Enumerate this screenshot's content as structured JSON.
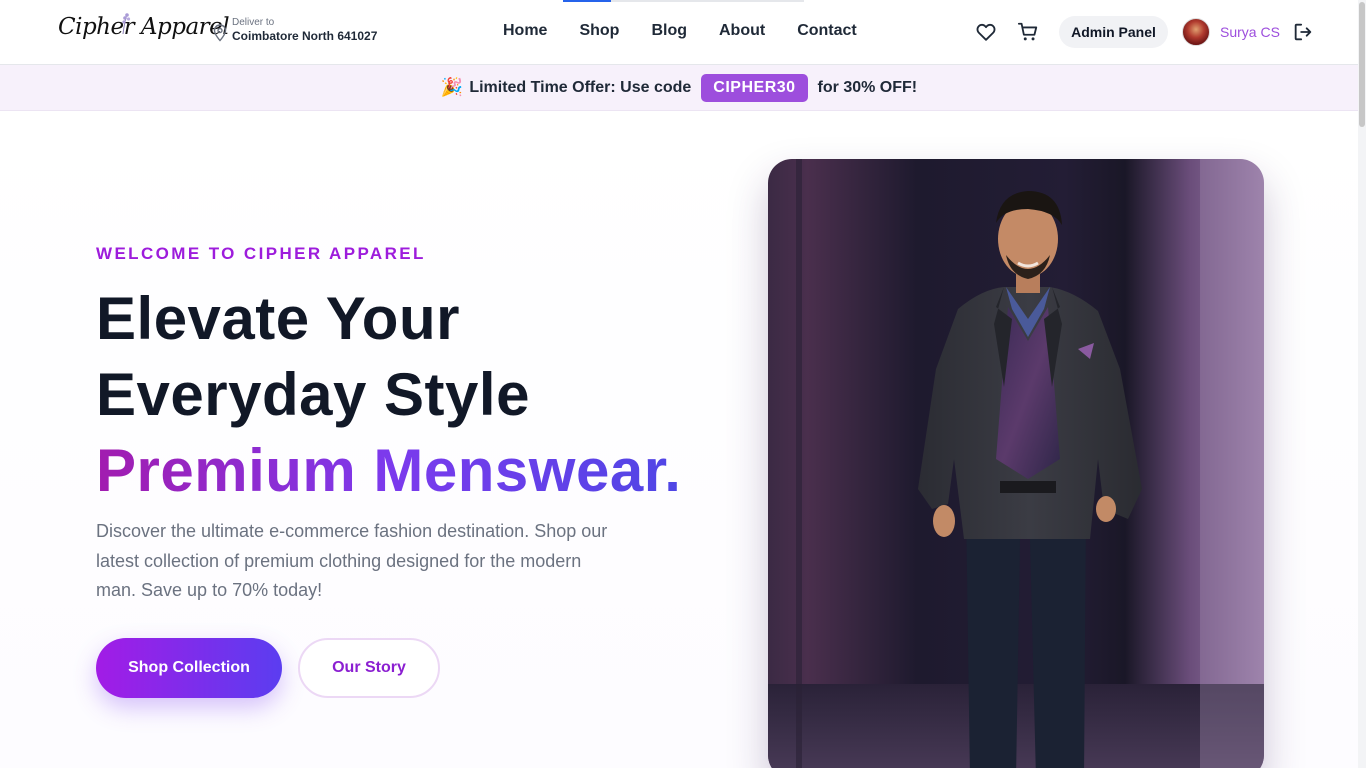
{
  "header": {
    "logo": "Cipher Apparel",
    "deliver_label": "Deliver to",
    "deliver_location": "Coimbatore North 641027",
    "nav": [
      "Home",
      "Shop",
      "Blog",
      "About",
      "Contact"
    ],
    "admin_label": "Admin Panel",
    "user_name": "Surya CS"
  },
  "promo": {
    "emoji": "🎉",
    "lead": "Limited Time Offer: Use code",
    "code": "CIPHER30",
    "tail": "for 30% OFF!"
  },
  "hero": {
    "eyebrow": "WELCOME TO CIPHER APPAREL",
    "line1": "Elevate Your",
    "line2": "Everyday Style",
    "line3": "Premium Menswear.",
    "description": "Discover the ultimate e-commerce fashion destination. Shop our latest collection of premium clothing designed for the modern man. Save up to 70% today!",
    "primary_cta": "Shop Collection",
    "secondary_cta": "Our Story"
  },
  "colors": {
    "accent": "#9d4edd",
    "accent_gradient_start": "#a21ce6",
    "accent_gradient_end": "#5b3df0",
    "promo_bg": "#f7f1fb",
    "nav_active": "#2563eb"
  },
  "icons": [
    "location-pin-icon",
    "heart-icon",
    "cart-icon",
    "logout-icon"
  ]
}
